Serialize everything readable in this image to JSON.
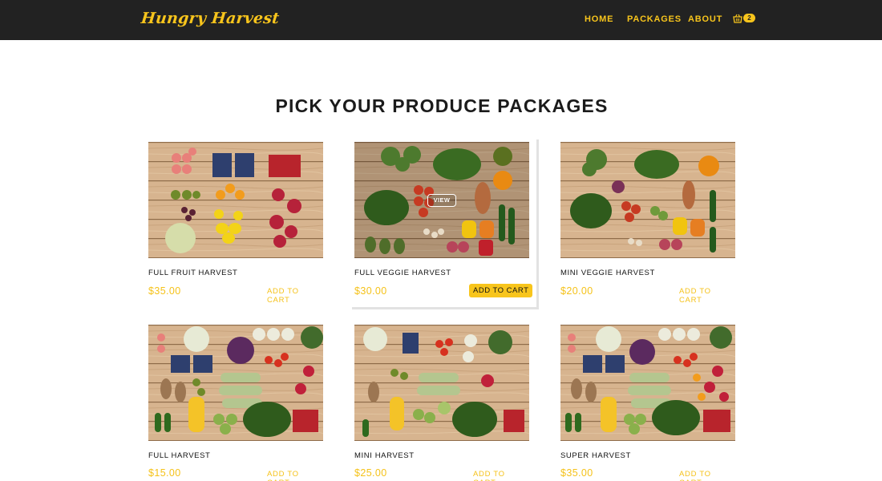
{
  "brand": {
    "name": "Hungry Harvest",
    "accent": "#f8c51c",
    "nav_bg": "#222222"
  },
  "nav": {
    "links": [
      "HOME",
      "PACKAGES",
      "ABOUT"
    ],
    "cart_count": "2",
    "cart_icon": "basket-icon"
  },
  "page": {
    "title": "PICK YOUR PRODUCE PACKAGES"
  },
  "products": [
    {
      "name": "FULL FRUIT HARVEST",
      "price": "$35.00",
      "cta": "ADD TO CART"
    },
    {
      "name": "FULL VEGGIE HARVEST",
      "price": "$30.00",
      "cta": "ADD TO CART",
      "overlay": "VIEW"
    },
    {
      "name": "MINI VEGGIE HARVEST",
      "price": "$20.00",
      "cta": "ADD TO CART"
    },
    {
      "name": "FULL HARVEST",
      "price": "$15.00",
      "cta": "ADD TO CART"
    },
    {
      "name": "MINI HARVEST",
      "price": "$25.00",
      "cta": "ADD TO CART"
    },
    {
      "name": "SUPER HARVEST",
      "price": "$35.00",
      "cta": "ADD TO CART"
    }
  ]
}
